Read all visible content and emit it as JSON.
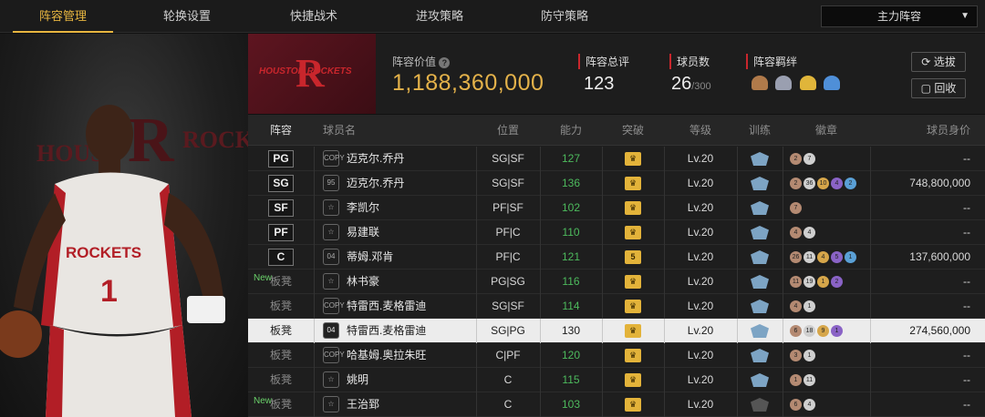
{
  "nav": {
    "tabs": [
      "阵容管理",
      "轮换设置",
      "快捷战术",
      "进攻策略",
      "防守策略"
    ],
    "active_tab": 0,
    "lineup_select": "主力阵容"
  },
  "banner": {
    "team_logo_text": "HOUSTON ROCKETS",
    "lineup_value_label": "阵容价值",
    "lineup_value": "1,188,360,000",
    "overall_label": "阵容总评",
    "overall": "123",
    "players_label": "球员数",
    "players": "26",
    "players_max": "/300",
    "synergy_label": "阵容羁绊",
    "select_button": "选拔",
    "recycle_button": "回收"
  },
  "table": {
    "headers": [
      "阵容",
      "球员名",
      "位置",
      "能力",
      "突破",
      "等级",
      "训练",
      "徽章",
      "球员身价"
    ],
    "rows": [
      {
        "slot": "PG",
        "slot_type": "pos",
        "card": "COPY",
        "name": "迈克尔.乔丹",
        "position": "SG|SF",
        "ability": "127",
        "breakthrough": "",
        "level": "Lv.20",
        "badges": [
          "2",
          "7"
        ],
        "value": "--"
      },
      {
        "slot": "SG",
        "slot_type": "pos",
        "card": "95",
        "name": "迈克尔.乔丹",
        "position": "SG|SF",
        "ability": "136",
        "breakthrough": "",
        "level": "Lv.20",
        "badges": [
          "2",
          "36",
          "10",
          "4",
          "2"
        ],
        "value": "748,800,000"
      },
      {
        "slot": "SF",
        "slot_type": "pos",
        "card": "☆",
        "name": "李凯尔",
        "position": "PF|SF",
        "ability": "102",
        "breakthrough": "",
        "level": "Lv.20",
        "badges": [
          "7"
        ],
        "value": "--"
      },
      {
        "slot": "PF",
        "slot_type": "pos",
        "card": "☆",
        "name": "易建联",
        "position": "PF|C",
        "ability": "110",
        "breakthrough": "",
        "level": "Lv.20",
        "badges": [
          "4",
          "4"
        ],
        "value": "--"
      },
      {
        "slot": "C",
        "slot_type": "pos",
        "card": "04",
        "name": "蒂姆.邓肯",
        "position": "PF|C",
        "ability": "121",
        "breakthrough": "5",
        "level": "Lv.20",
        "badges": [
          "26",
          "11",
          "4",
          "5",
          "1"
        ],
        "value": "137,600,000"
      },
      {
        "slot": "板凳",
        "slot_type": "bench",
        "new": "New",
        "card": "☆",
        "name": "林书豪",
        "position": "PG|SG",
        "ability": "116",
        "breakthrough": "",
        "level": "Lv.20",
        "badges": [
          "11",
          "19",
          "1",
          "2"
        ],
        "value": "--"
      },
      {
        "slot": "板凳",
        "slot_type": "bench",
        "card": "COPY",
        "name": "特雷西.麦格雷迪",
        "position": "SG|SF",
        "ability": "114",
        "breakthrough": "",
        "level": "Lv.20",
        "badges": [
          "4",
          "1"
        ],
        "value": "--"
      },
      {
        "slot": "板凳",
        "slot_type": "bench",
        "highlight": true,
        "card": "04",
        "name": "特雷西.麦格雷迪",
        "position": "SG|PG",
        "ability": "130",
        "breakthrough": "",
        "level": "Lv.20",
        "badges": [
          "6",
          "18",
          "9",
          "1"
        ],
        "value": "274,560,000"
      },
      {
        "slot": "板凳",
        "slot_type": "bench",
        "card": "COPY",
        "name": "哈基姆.奥拉朱旺",
        "position": "C|PF",
        "ability": "120",
        "breakthrough": "",
        "level": "Lv.20",
        "badges": [
          "3",
          "1"
        ],
        "value": "--"
      },
      {
        "slot": "板凳",
        "slot_type": "bench",
        "card": "☆",
        "name": "姚明",
        "position": "C",
        "ability": "115",
        "breakthrough": "",
        "level": "Lv.20",
        "badges": [
          "1",
          "11"
        ],
        "value": "--"
      },
      {
        "slot": "板凳",
        "slot_type": "bench",
        "new": "New",
        "card": "☆",
        "name": "王治郅",
        "position": "C",
        "ability": "103",
        "breakthrough": "",
        "level": "Lv.20",
        "badges": [
          "6",
          "4"
        ],
        "value": "--"
      }
    ]
  },
  "colors": {
    "accent": "#e8b640",
    "value_gold": "#e4b24a",
    "ability_green": "#4dba5d",
    "rockets_red": "#c9262c"
  }
}
